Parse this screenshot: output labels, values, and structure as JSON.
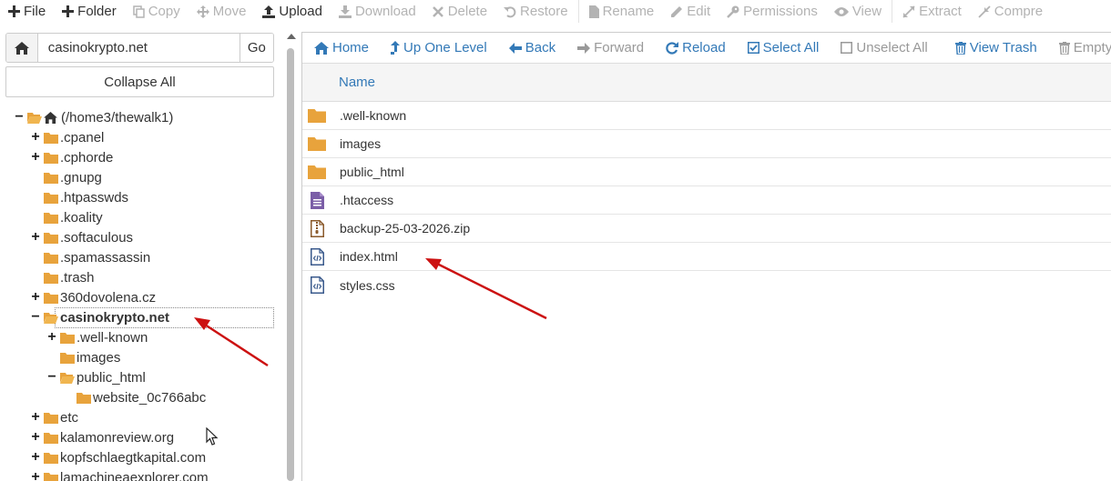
{
  "colors": {
    "accent": "#3379b7",
    "folder": "#e8a33c",
    "arrow": "#cc1111",
    "disabled": "#b3b3b3",
    "htaccess_icon": "#7b5ea7"
  },
  "toolbar": {
    "items": [
      {
        "label": "File",
        "icon": "plus-icon",
        "enabled": true
      },
      {
        "label": "Folder",
        "icon": "plus-icon",
        "enabled": true
      },
      {
        "label": "Copy",
        "icon": "copy-icon",
        "enabled": false
      },
      {
        "label": "Move",
        "icon": "move-icon",
        "enabled": false
      },
      {
        "label": "Upload",
        "icon": "upload-icon",
        "enabled": true
      },
      {
        "label": "Download",
        "icon": "download-icon",
        "enabled": false
      },
      {
        "label": "Delete",
        "icon": "close-icon",
        "enabled": false
      },
      {
        "label": "Restore",
        "icon": "undo-icon",
        "enabled": false
      },
      {
        "label": "Rename",
        "icon": "file-icon",
        "enabled": false
      },
      {
        "label": "Edit",
        "icon": "pencil-icon",
        "enabled": false
      },
      {
        "label": "Permissions",
        "icon": "key-icon",
        "enabled": false
      },
      {
        "label": "View",
        "icon": "eye-icon",
        "enabled": false
      },
      {
        "label": "Extract",
        "icon": "expand-icon",
        "enabled": false
      },
      {
        "label": "Compre",
        "icon": "compress-icon",
        "enabled": false
      }
    ]
  },
  "path_bar": {
    "value": "casinokrypto.net",
    "go_label": "Go"
  },
  "collapse_all_label": "Collapse All",
  "tree": {
    "root_label": "(/home3/thewalk1)",
    "items": [
      {
        "label": ".cpanel",
        "toggle": "+"
      },
      {
        "label": ".cphorde",
        "toggle": "+"
      },
      {
        "label": ".gnupg",
        "toggle": ""
      },
      {
        "label": ".htpasswds",
        "toggle": ""
      },
      {
        "label": ".koality",
        "toggle": ""
      },
      {
        "label": ".softaculous",
        "toggle": "+"
      },
      {
        "label": ".spamassassin",
        "toggle": ""
      },
      {
        "label": ".trash",
        "toggle": ""
      },
      {
        "label": "360dovolena.cz",
        "toggle": "+"
      },
      {
        "label": "casinokrypto.net",
        "toggle": "−"
      },
      {
        "label": ".well-known",
        "toggle": "+"
      },
      {
        "label": "images",
        "toggle": ""
      },
      {
        "label": "public_html",
        "toggle": "−"
      },
      {
        "label": "website_0c766abc",
        "toggle": ""
      },
      {
        "label": "etc",
        "toggle": "+"
      },
      {
        "label": "kalamonreview.org",
        "toggle": "+"
      },
      {
        "label": "kopfschlaegtkapital.com",
        "toggle": "+"
      },
      {
        "label": "lamachineaexplorer.com",
        "toggle": "+"
      }
    ]
  },
  "nav": {
    "items": [
      {
        "label": "Home",
        "icon": "home-icon",
        "enabled": true
      },
      {
        "label": "Up One Level",
        "icon": "level-up-icon",
        "enabled": true
      },
      {
        "label": "Back",
        "icon": "arrow-left-icon",
        "enabled": true
      },
      {
        "label": "Forward",
        "icon": "arrow-right-icon",
        "enabled": false
      },
      {
        "label": "Reload",
        "icon": "refresh-icon",
        "enabled": true
      },
      {
        "label": "Select All",
        "icon": "checkbox-checked-icon",
        "enabled": true
      },
      {
        "label": "Unselect All",
        "icon": "checkbox-empty-icon",
        "enabled": false
      },
      {
        "label": "View Trash",
        "icon": "trash-icon",
        "enabled": true
      },
      {
        "label": "Empty Tr",
        "icon": "trash-icon",
        "enabled": false
      }
    ]
  },
  "file_list": {
    "column_name": "Name",
    "files": [
      {
        "name": ".well-known",
        "type": "folder"
      },
      {
        "name": "images",
        "type": "folder"
      },
      {
        "name": "public_html",
        "type": "folder"
      },
      {
        "name": ".htaccess",
        "type": "text"
      },
      {
        "name": "backup-25-03-2026.zip",
        "type": "zip"
      },
      {
        "name": "index.html",
        "type": "code"
      },
      {
        "name": "styles.css",
        "type": "code"
      }
    ]
  }
}
